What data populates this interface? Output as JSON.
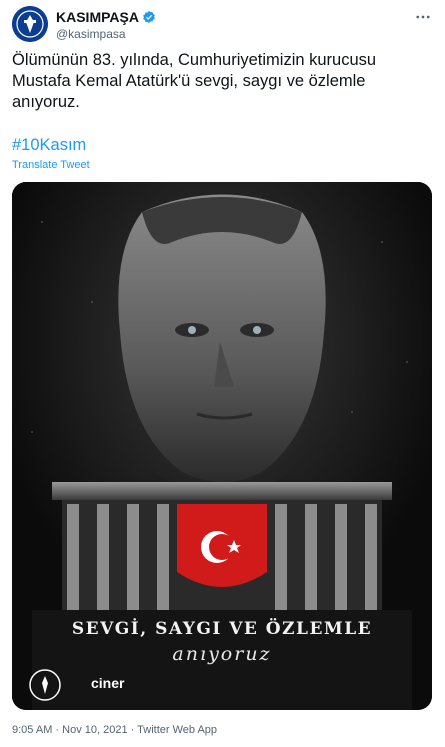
{
  "account": {
    "display_name": "KASIMPAŞA",
    "handle": "@kasimpasa",
    "avatar_icon": "kasimpasa-crest-icon",
    "verified_icon": "verified-badge-icon",
    "more_icon": "more-options-icon"
  },
  "tweet": {
    "text": "Ölümünün 83. yılında, Cumhuriyetimizin kurucusu\nMustafa Kemal Atatürk'ü sevgi, saygı ve özlemle\nanıyoruz.",
    "hashtag": "#10Kasım",
    "translate_label": "Translate Tweet"
  },
  "media": {
    "caption_line1": "SEVGİ, SAYGI VE ÖZLEMLE",
    "caption_line2": "anıyoruz",
    "sponsor_text": "ciner"
  },
  "meta": {
    "timestamp": "9:05 AM · Nov 10, 2021 · Twitter Web App"
  },
  "colors": {
    "link": "#1d9bf0",
    "secondary_text": "#536471",
    "primary_text": "#0f1419",
    "flag_red": "#d11a1a"
  }
}
